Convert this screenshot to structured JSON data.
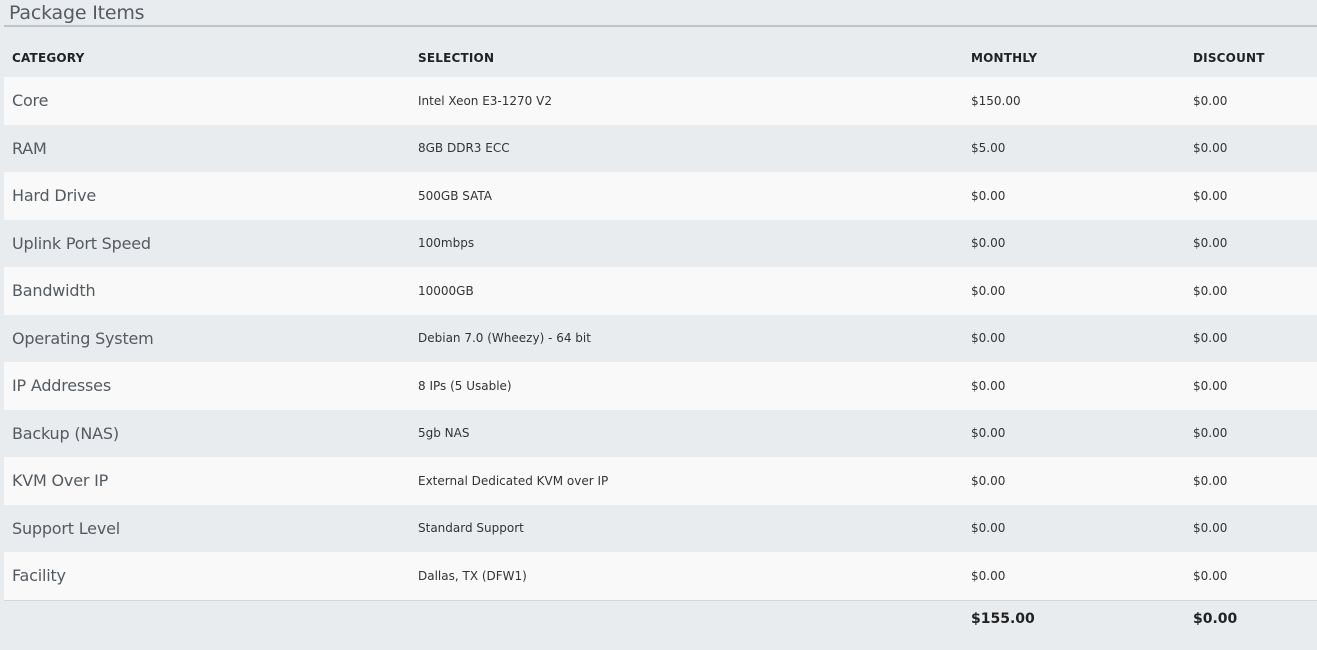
{
  "panel": {
    "title": "Package Items"
  },
  "table": {
    "headers": {
      "category": "CATEGORY",
      "selection": "SELECTION",
      "monthly": "MONTHLY",
      "discount": "DISCOUNT"
    },
    "rows": [
      {
        "category": "Core",
        "selection": "Intel Xeon E3-1270 V2",
        "monthly": "$150.00",
        "discount": "$0.00"
      },
      {
        "category": "RAM",
        "selection": "8GB DDR3 ECC",
        "monthly": "$5.00",
        "discount": "$0.00"
      },
      {
        "category": "Hard Drive",
        "selection": "500GB SATA",
        "monthly": "$0.00",
        "discount": "$0.00"
      },
      {
        "category": "Uplink Port Speed",
        "selection": "100mbps",
        "monthly": "$0.00",
        "discount": "$0.00"
      },
      {
        "category": "Bandwidth",
        "selection": "10000GB",
        "monthly": "$0.00",
        "discount": "$0.00"
      },
      {
        "category": "Operating System",
        "selection": "Debian 7.0 (Wheezy) - 64 bit",
        "monthly": "$0.00",
        "discount": "$0.00"
      },
      {
        "category": "IP Addresses",
        "selection": "8 IPs (5 Usable)",
        "monthly": "$0.00",
        "discount": "$0.00"
      },
      {
        "category": "Backup (NAS)",
        "selection": "5gb NAS",
        "monthly": "$0.00",
        "discount": "$0.00"
      },
      {
        "category": "KVM Over IP",
        "selection": "External Dedicated KVM over IP",
        "monthly": "$0.00",
        "discount": "$0.00"
      },
      {
        "category": "Support Level",
        "selection": "Standard Support",
        "monthly": "$0.00",
        "discount": "$0.00"
      },
      {
        "category": "Facility",
        "selection": "Dallas, TX (DFW1)",
        "monthly": "$0.00",
        "discount": "$0.00"
      }
    ],
    "totals": {
      "monthly": "$155.00",
      "discount": "$0.00"
    }
  },
  "colors": {
    "page_background": "#e9ecef",
    "row_light": "#f9f9f9",
    "row_dark": "#e9ecef",
    "title_rule": "#bfc4c8"
  }
}
